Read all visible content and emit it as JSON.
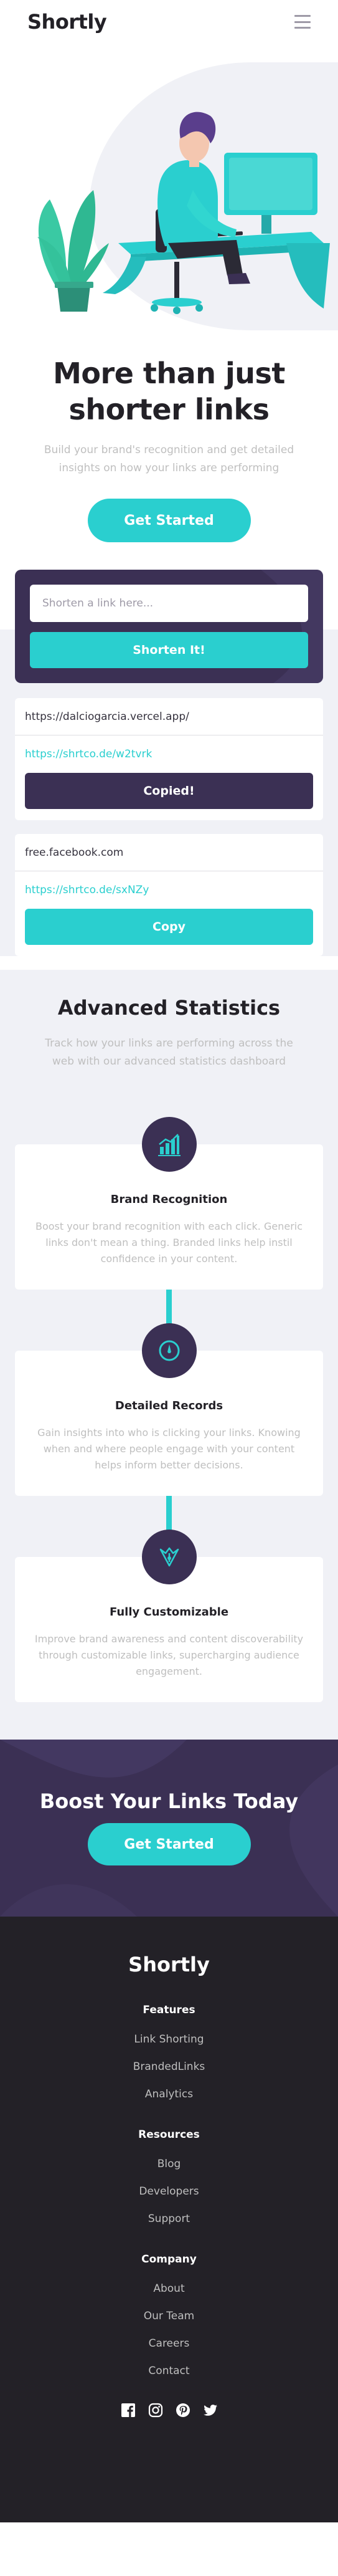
{
  "header": {
    "logo": "Shortly",
    "menu_icon": "hamburger-menu-icon"
  },
  "hero": {
    "illustration": "person-working-at-desk-illustration",
    "title": "More than just shorter links",
    "subtitle": "Build your brand's recognition and get detailed insights on how your links are performing",
    "cta": "Get Started"
  },
  "shorten": {
    "placeholder": "Shorten a link here...",
    "button": "Shorten It!",
    "results": [
      {
        "original": "https://dalciogarcia.vercel.app/",
        "short": "https://shrtco.de/w2tvrk",
        "button": "Copied!",
        "state": "copied"
      },
      {
        "original": "free.facebook.com",
        "short": "https://shrtco.de/sxNZy",
        "button": "Copy",
        "state": "copy"
      }
    ]
  },
  "stats": {
    "title": "Advanced Statistics",
    "subtitle": "Track how your links are performing across the web with our advanced statistics dashboard",
    "features": [
      {
        "icon": "brand-recognition-chart-icon",
        "title": "Brand Recognition",
        "description": "Boost your brand recognition with each click. Generic links don't mean a thing. Branded links help instil confidence in your content."
      },
      {
        "icon": "detailed-records-gauge-icon",
        "title": "Detailed Records",
        "description": "Gain insights into who is clicking your links. Knowing when and where people engage with your content helps inform better decisions."
      },
      {
        "icon": "fully-customizable-pen-icon",
        "title": "Fully Customizable",
        "description": "Improve brand awareness and content discoverability through customizable links, supercharging audience engagement."
      }
    ]
  },
  "boost": {
    "title": "Boost Your Links Today",
    "cta": "Get Started"
  },
  "footer": {
    "logo": "Shortly",
    "columns": [
      {
        "heading": "Features",
        "links": [
          "Link Shorting",
          "BrandedLinks",
          "Analytics"
        ]
      },
      {
        "heading": "Resources",
        "links": [
          "Blog",
          "Developers",
          "Support"
        ]
      },
      {
        "heading": "Company",
        "links": [
          "About",
          "Our Team",
          "Careers",
          "Contact"
        ]
      }
    ],
    "socials": [
      "facebook-icon",
      "instagram-icon",
      "pinterest-icon",
      "twitter-icon"
    ]
  },
  "colors": {
    "cyan": "#2acfcf",
    "dark_violet": "#3b3054",
    "very_dark": "#232127",
    "gray_bg": "#f0f1f6",
    "gray_text": "#bfbfbf"
  }
}
